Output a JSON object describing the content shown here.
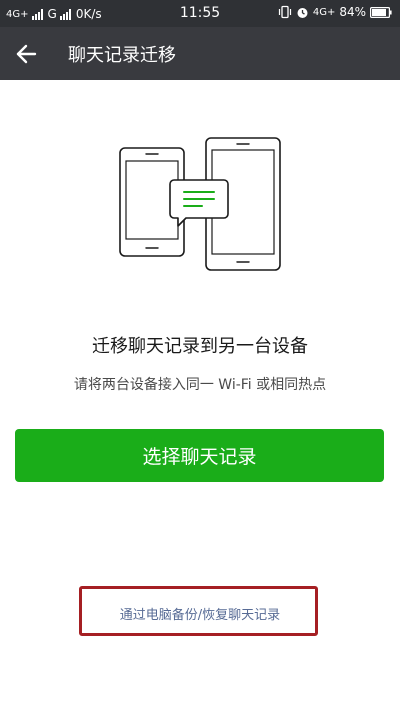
{
  "status_bar": {
    "network_1": "4G+",
    "network_2": "G",
    "speed": "0K/s",
    "time": "11:55",
    "network_3": "4G+",
    "battery": "84%"
  },
  "title_bar": {
    "title": "聊天记录迁移",
    "back_icon": "arrow-left-icon"
  },
  "main": {
    "headline": "迁移聊天记录到另一台设备",
    "subtitle": "请将两台设备接入同一 Wi-Fi 或相同热点",
    "primary_button": "选择聊天记录",
    "secondary_link": "通过电脑备份/恢复聊天记录"
  },
  "colors": {
    "status_bar_bg": "#2f3135",
    "title_bar_bg": "#393a3f",
    "accent_green": "#1aad19",
    "link_blue": "#576b95",
    "annotation_red": "#a51f23"
  }
}
